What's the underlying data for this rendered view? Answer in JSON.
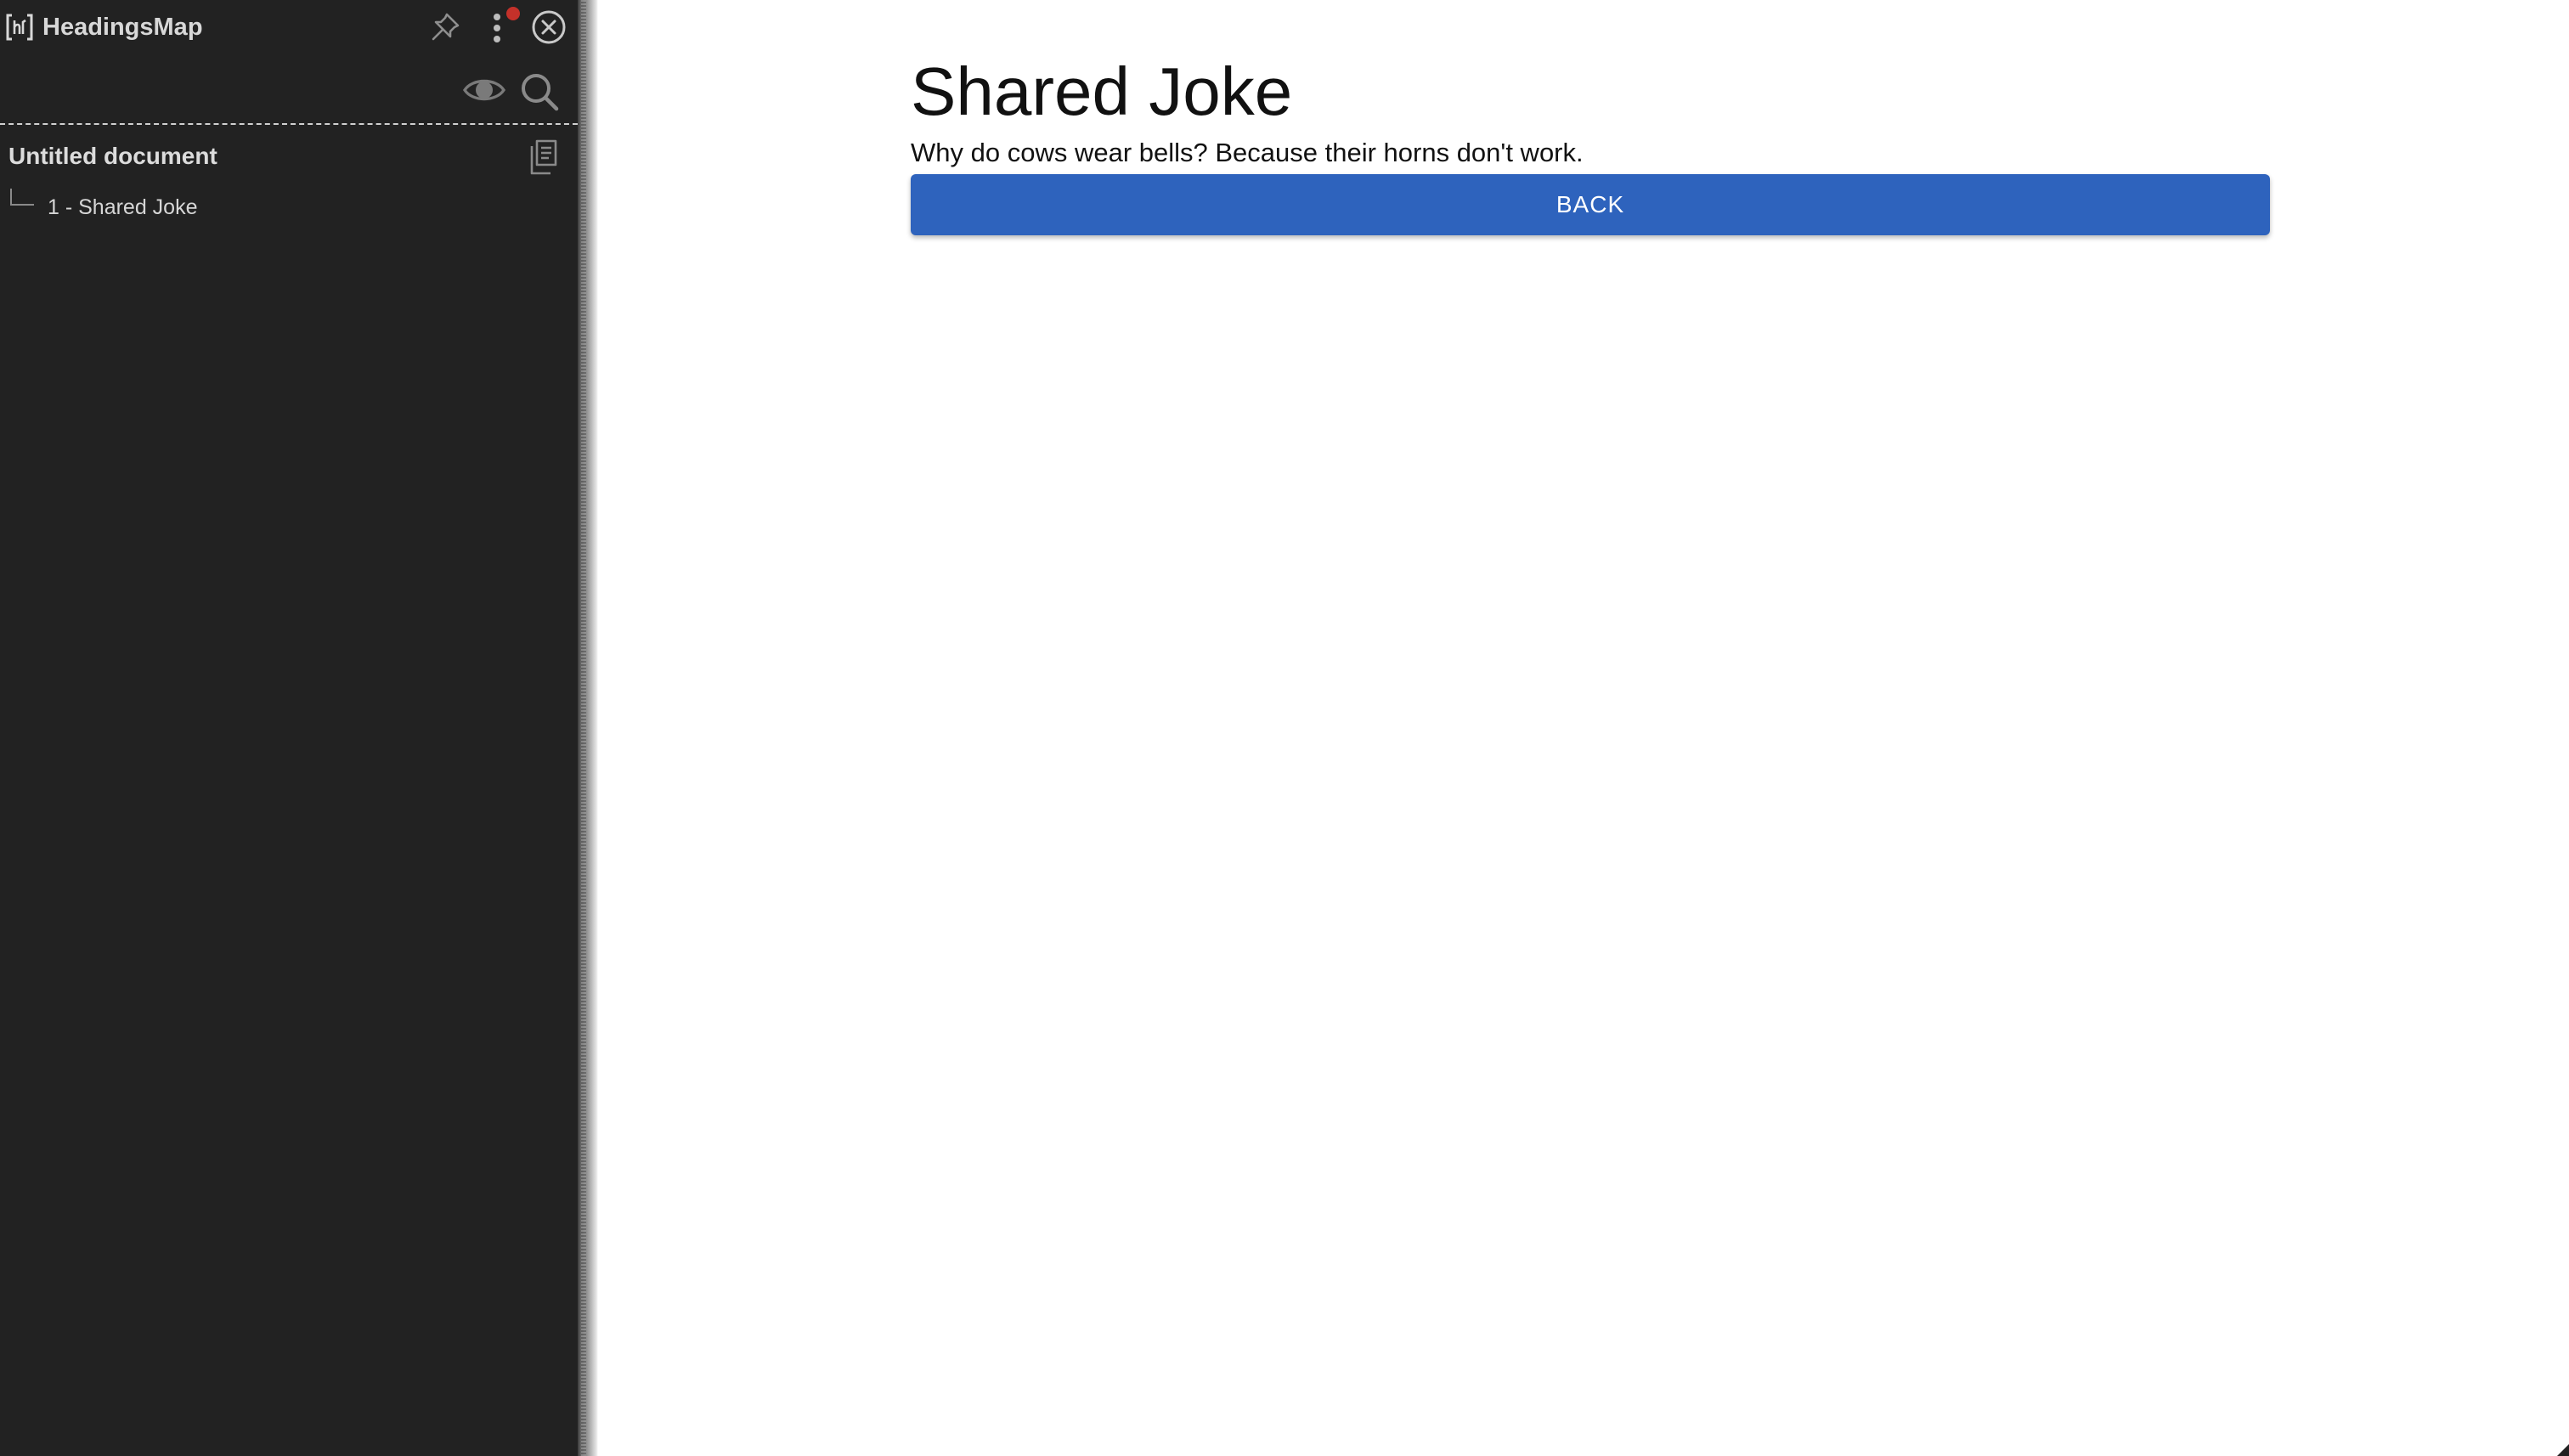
{
  "extension": {
    "name": "HeadingsMap",
    "document_title": "Untitled document",
    "headings": [
      {
        "number": "1",
        "separator": " - ",
        "text": "Shared Joke"
      }
    ],
    "icons": {
      "logo": "headingsmap-logo-icon",
      "pin": "pin-icon",
      "menu": "more-vertical-icon",
      "close": "close-circle-icon",
      "eye": "eye-icon",
      "search": "search-icon",
      "copy": "copy-icon"
    },
    "colors": {
      "background": "#222222",
      "text": "#d8d8d8",
      "notification": "#c4312a"
    }
  },
  "page": {
    "title": "Shared Joke",
    "joke": "Why do cows wear bells? Because their horns don't work.",
    "back_label": "BACK",
    "colors": {
      "button": "#2e63bd",
      "button_text": "#ffffff",
      "text": "#111111"
    }
  }
}
